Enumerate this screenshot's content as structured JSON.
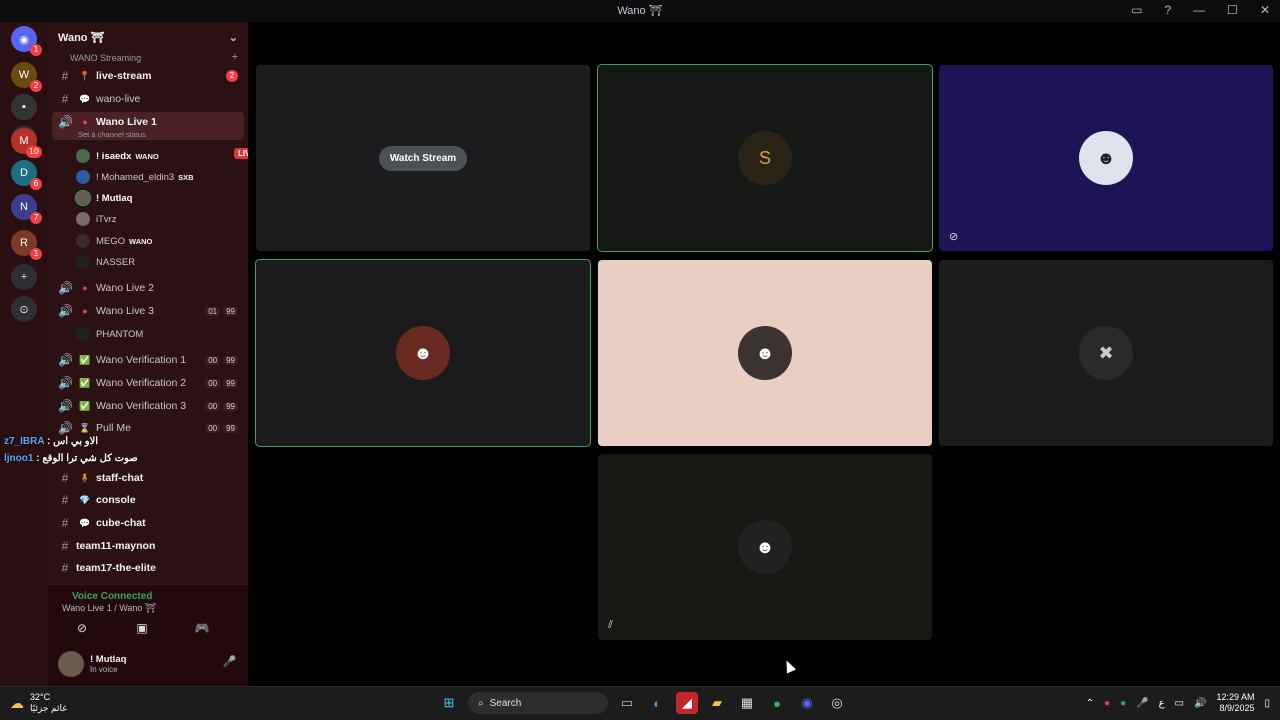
{
  "window": {
    "title": "Wano ⛩"
  },
  "server": {
    "name": "Wano ⛩"
  },
  "rail_badges": [
    "1",
    "2",
    "",
    "",
    "10",
    "6",
    "7",
    "1"
  ],
  "category": "WANO Streaming",
  "channels": [
    {
      "id": "live-stream",
      "name": "live-stream",
      "emoji": "📍",
      "badge": "2",
      "bold": true
    },
    {
      "id": "wano-live",
      "name": "wano-live",
      "emoji": "💬",
      "bold": false
    }
  ],
  "voice_active": {
    "name": "Wano Live 1",
    "status_hint": "Set a channel status"
  },
  "voice_users": [
    {
      "name": "! isaedx",
      "tag": "WANO",
      "live": "LIVE"
    },
    {
      "name": "! Mohamed_eldin3",
      "tag": "SXB"
    },
    {
      "name": "! Mutlaq"
    },
    {
      "name": "iTvrz"
    },
    {
      "name": "MEGO",
      "tag": "WANO"
    },
    {
      "name": "NASSER"
    }
  ],
  "voice_channels": [
    {
      "name": "Wano Live 2"
    },
    {
      "name": "Wano Live 3",
      "counts": [
        "01",
        "99"
      ]
    },
    {
      "name": "PHANTOM"
    },
    {
      "name": "Wano Verification 1",
      "counts": [
        "00",
        "99"
      ]
    },
    {
      "name": "Wano Verification 2",
      "counts": [
        "00",
        "99"
      ]
    },
    {
      "name": "Wano Verification 3",
      "counts": [
        "00",
        "99"
      ]
    },
    {
      "name": "Pull Me",
      "counts": [
        "00",
        "99"
      ]
    }
  ],
  "overlay_chat": [
    {
      "user": "z7_IBRA",
      "msg": ": الاو بي اس"
    },
    {
      "user": "ljnoo1",
      "msg": ": صوت كل شي ترا الوقع"
    }
  ],
  "text_channels": [
    {
      "name": "staff-chat",
      "emoji": "🧍"
    },
    {
      "name": "console",
      "emoji": "💎"
    },
    {
      "name": "cube-chat",
      "emoji": "💬"
    },
    {
      "name": "team11-maynon"
    },
    {
      "name": "team17-the-elite"
    }
  ],
  "voice_connected": {
    "title": "Voice Connected",
    "subtitle": "Wano Live 1 / Wano ⛩"
  },
  "me": {
    "name": "! Mutlaq",
    "status": "In voice"
  },
  "stage": {
    "watch_label": "Watch Stream"
  },
  "taskbar": {
    "weather_temp": "32°C",
    "weather_desc": "غائم جزئيًا",
    "search_placeholder": "Search",
    "time": "12:29 AM",
    "date": "8/9/2025",
    "lang": "ع"
  }
}
